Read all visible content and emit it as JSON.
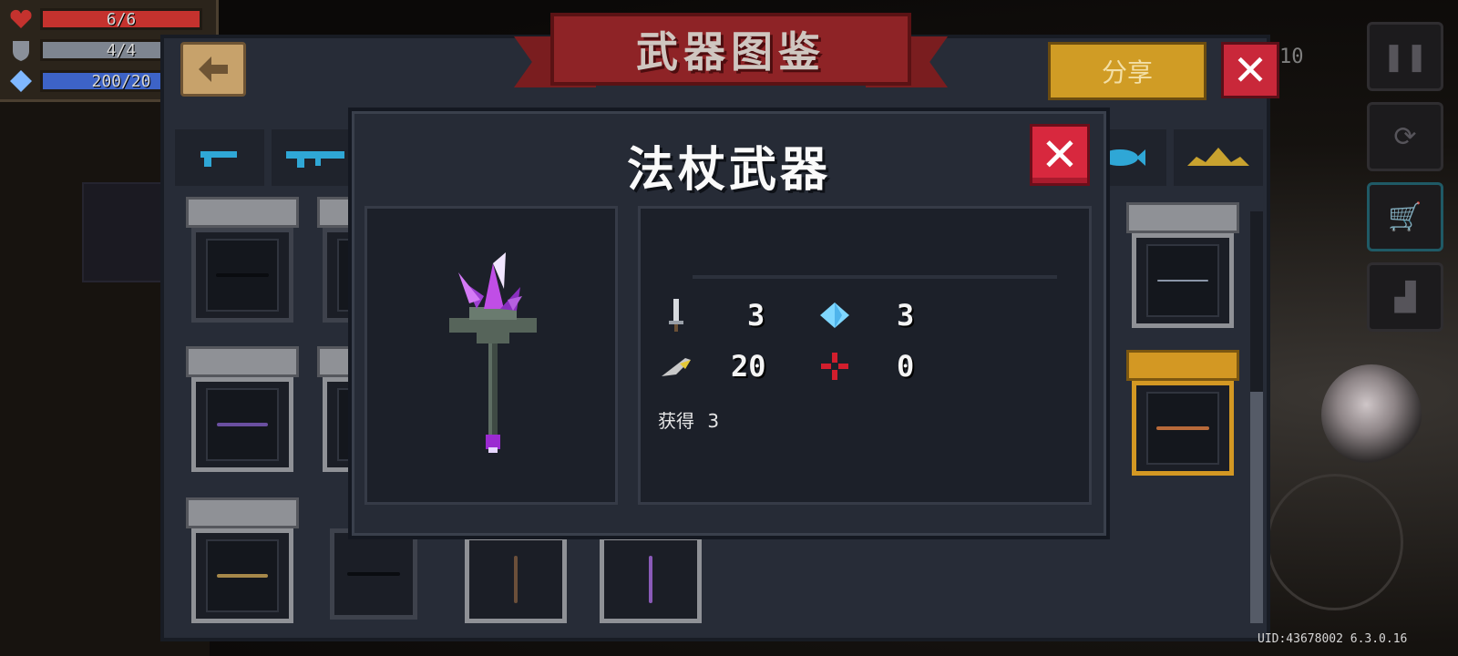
{
  "hud": {
    "health": {
      "text": "6/6",
      "value": 6,
      "max": 6,
      "color": "#c4322e"
    },
    "armor": {
      "text": "4/4",
      "value": 4,
      "max": 4,
      "color": "#7e8590"
    },
    "energy": {
      "text": "200/20",
      "value": 200,
      "max": 200,
      "color": "#3d63c7"
    }
  },
  "codex": {
    "title": "武器图鉴",
    "share_label": "分享",
    "floor_text": "10"
  },
  "tabs": [
    {
      "icon": "pistol-icon",
      "color": "#2fa7d6"
    },
    {
      "icon": "rifle-icon",
      "color": "#2fa7d6"
    },
    {
      "icon": "fish-icon",
      "color": "#2fa7d6"
    },
    {
      "icon": "crown-icon",
      "color": "#c8a22f"
    }
  ],
  "modal": {
    "title": "法杖武器",
    "stats": {
      "damage": "3",
      "energy_cost": "3",
      "crit": "20",
      "accuracy": "0"
    },
    "obtained_label": "获得",
    "obtained_count": "3"
  },
  "uid": "UID:43678002 6.3.0.16"
}
